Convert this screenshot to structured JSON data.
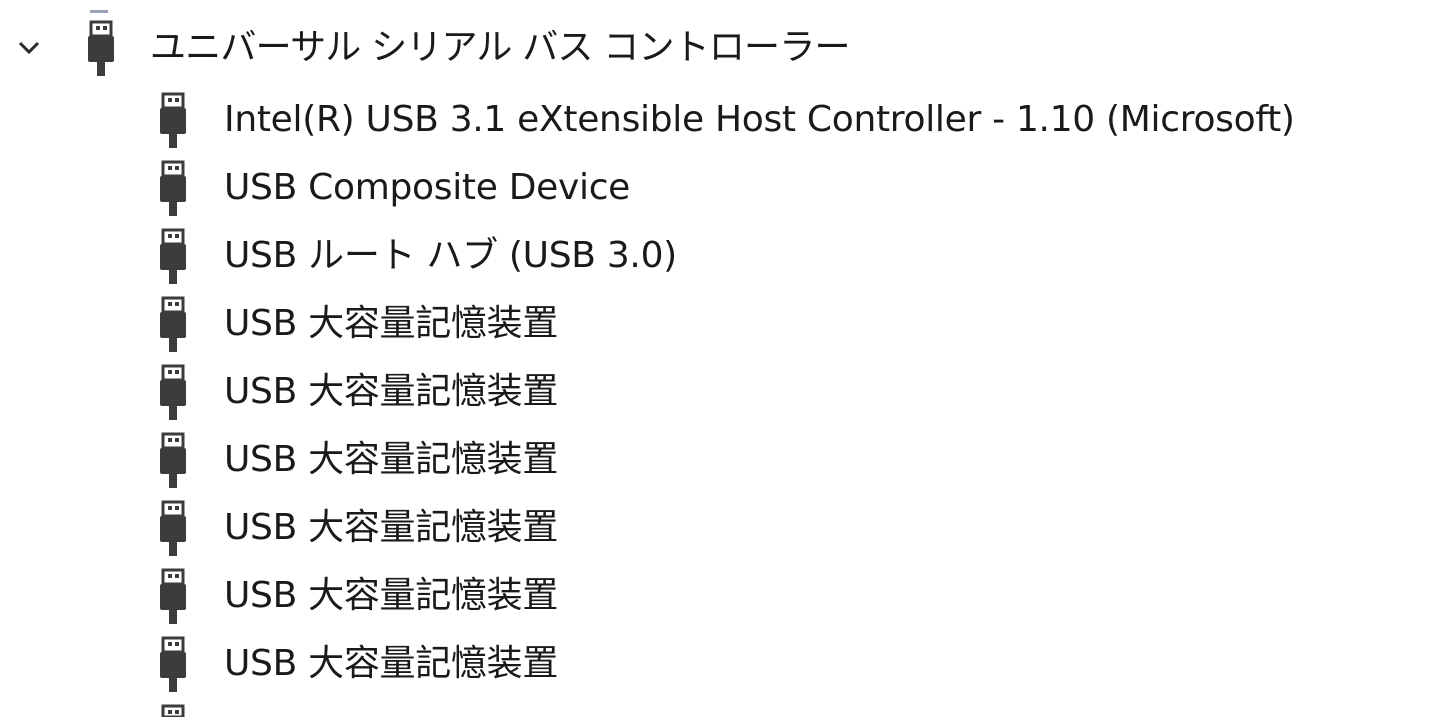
{
  "tree": {
    "group": {
      "label": "ユニバーサル シリアル バス コントローラー",
      "expanded": true,
      "expander_icon": "chevron-down-icon",
      "icon": "usb-plug-icon"
    },
    "devices": [
      {
        "label": "Intel(R) USB 3.1 eXtensible Host Controller - 1.10 (Microsoft)",
        "icon": "usb-plug-icon"
      },
      {
        "label": "USB Composite Device",
        "icon": "usb-plug-icon"
      },
      {
        "label": "USB ルート ハブ (USB 3.0)",
        "icon": "usb-plug-icon"
      },
      {
        "label": "USB 大容量記憶装置",
        "icon": "usb-plug-icon"
      },
      {
        "label": "USB 大容量記憶装置",
        "icon": "usb-plug-icon"
      },
      {
        "label": "USB 大容量記憶装置",
        "icon": "usb-plug-icon"
      },
      {
        "label": "USB 大容量記憶装置",
        "icon": "usb-plug-icon"
      },
      {
        "label": "USB 大容量記憶装置",
        "icon": "usb-plug-icon"
      },
      {
        "label": "USB 大容量記憶装置",
        "icon": "usb-plug-icon"
      }
    ]
  },
  "colors": {
    "text": "#1a1a1a",
    "icon": "#3c3c3c",
    "icon_dark": "#1e1e1e",
    "background": "#ffffff"
  }
}
